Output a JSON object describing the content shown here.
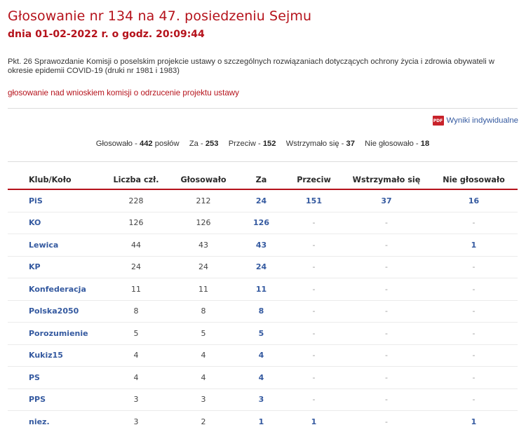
{
  "title": "Głosowanie nr 134 na 47. posiedzeniu Sejmu",
  "date": "dnia 01-02-2022 r. o godz. 20:09:44",
  "description": "Pkt. 26 Sprawozdanie Komisji o poselskim projekcie ustawy o szczególnych rozwiązaniach dotyczących ochrony życia i zdrowia obywateli w okresie epidemii COVID-19 (druki nr 1981 i 1983)",
  "subject": "głosowanie nad wnioskiem komisji o odrzucenie projektu ustawy",
  "pdf_link": {
    "icon": "PDF",
    "label": "Wyniki indywidualne"
  },
  "summary": {
    "voted_label": "Głosowało -",
    "voted_value": "442",
    "voted_unit": "posłów",
    "za_label": "Za -",
    "za_value": "253",
    "przeciw_label": "Przeciw -",
    "przeciw_value": "152",
    "wstrzymalo_label": "Wstrzymało się -",
    "wstrzymalo_value": "37",
    "nie_glosowalo_label": "Nie głosowało -",
    "nie_glosowalo_value": "18"
  },
  "table": {
    "headers": [
      "Klub/Koło",
      "Liczba czł.",
      "Głosowało",
      "Za",
      "Przeciw",
      "Wstrzymało się",
      "Nie głosowało"
    ],
    "rows": [
      [
        "PiS",
        "228",
        "212",
        "24",
        "151",
        "37",
        "16"
      ],
      [
        "KO",
        "126",
        "126",
        "126",
        "-",
        "-",
        "-"
      ],
      [
        "Lewica",
        "44",
        "43",
        "43",
        "-",
        "-",
        "1"
      ],
      [
        "KP",
        "24",
        "24",
        "24",
        "-",
        "-",
        "-"
      ],
      [
        "Konfederacja",
        "11",
        "11",
        "11",
        "-",
        "-",
        "-"
      ],
      [
        "Polska2050",
        "8",
        "8",
        "8",
        "-",
        "-",
        "-"
      ],
      [
        "Porozumienie",
        "5",
        "5",
        "5",
        "-",
        "-",
        "-"
      ],
      [
        "Kukiz15",
        "4",
        "4",
        "4",
        "-",
        "-",
        "-"
      ],
      [
        "PS",
        "4",
        "4",
        "4",
        "-",
        "-",
        "-"
      ],
      [
        "PPS",
        "3",
        "3",
        "3",
        "-",
        "-",
        "-"
      ],
      [
        "niez.",
        "3",
        "2",
        "1",
        "1",
        "-",
        "1"
      ]
    ]
  },
  "colors": {
    "accent": "#b5121b",
    "link": "#355aa0"
  }
}
